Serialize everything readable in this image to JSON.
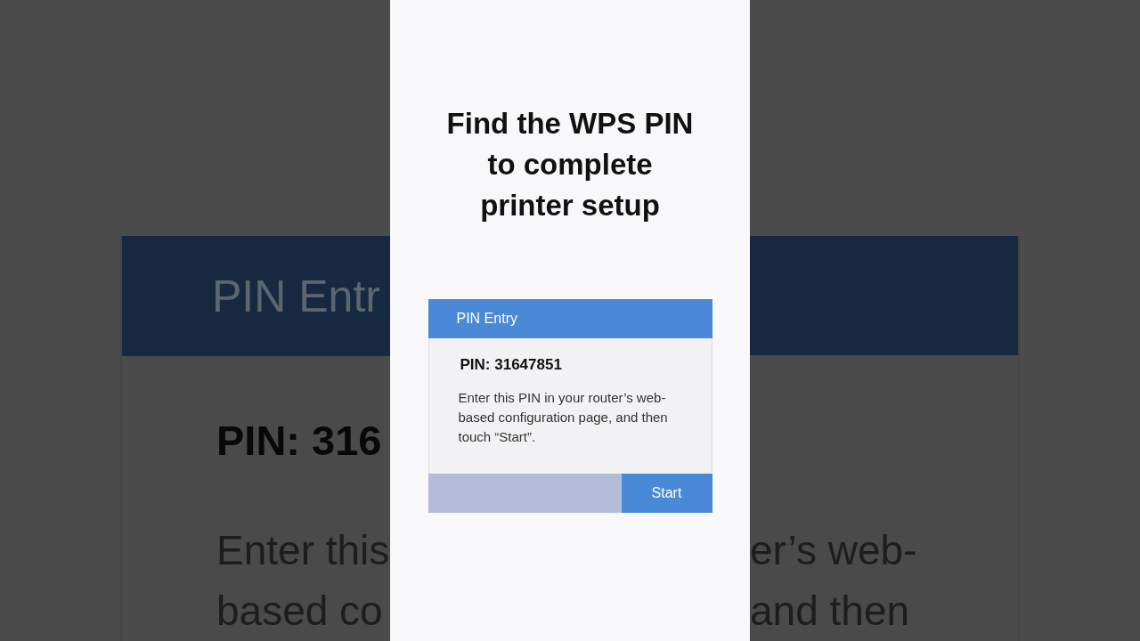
{
  "backdrop": {
    "left": {
      "header": "PIN Entr",
      "pin": "PIN: 316",
      "lines": [
        "Enter this",
        "based co"
      ]
    },
    "right": {
      "lines": [
        "er’s web-",
        "and then"
      ]
    }
  },
  "headline": [
    "Find the WPS PIN",
    "to complete",
    "printer setup"
  ],
  "dialog": {
    "title": "PIN Entry",
    "pin": "PIN: 31647851",
    "message": "Enter this PIN in your router’s web-based configuration page, and then touch “Start”.",
    "button": "Start"
  }
}
